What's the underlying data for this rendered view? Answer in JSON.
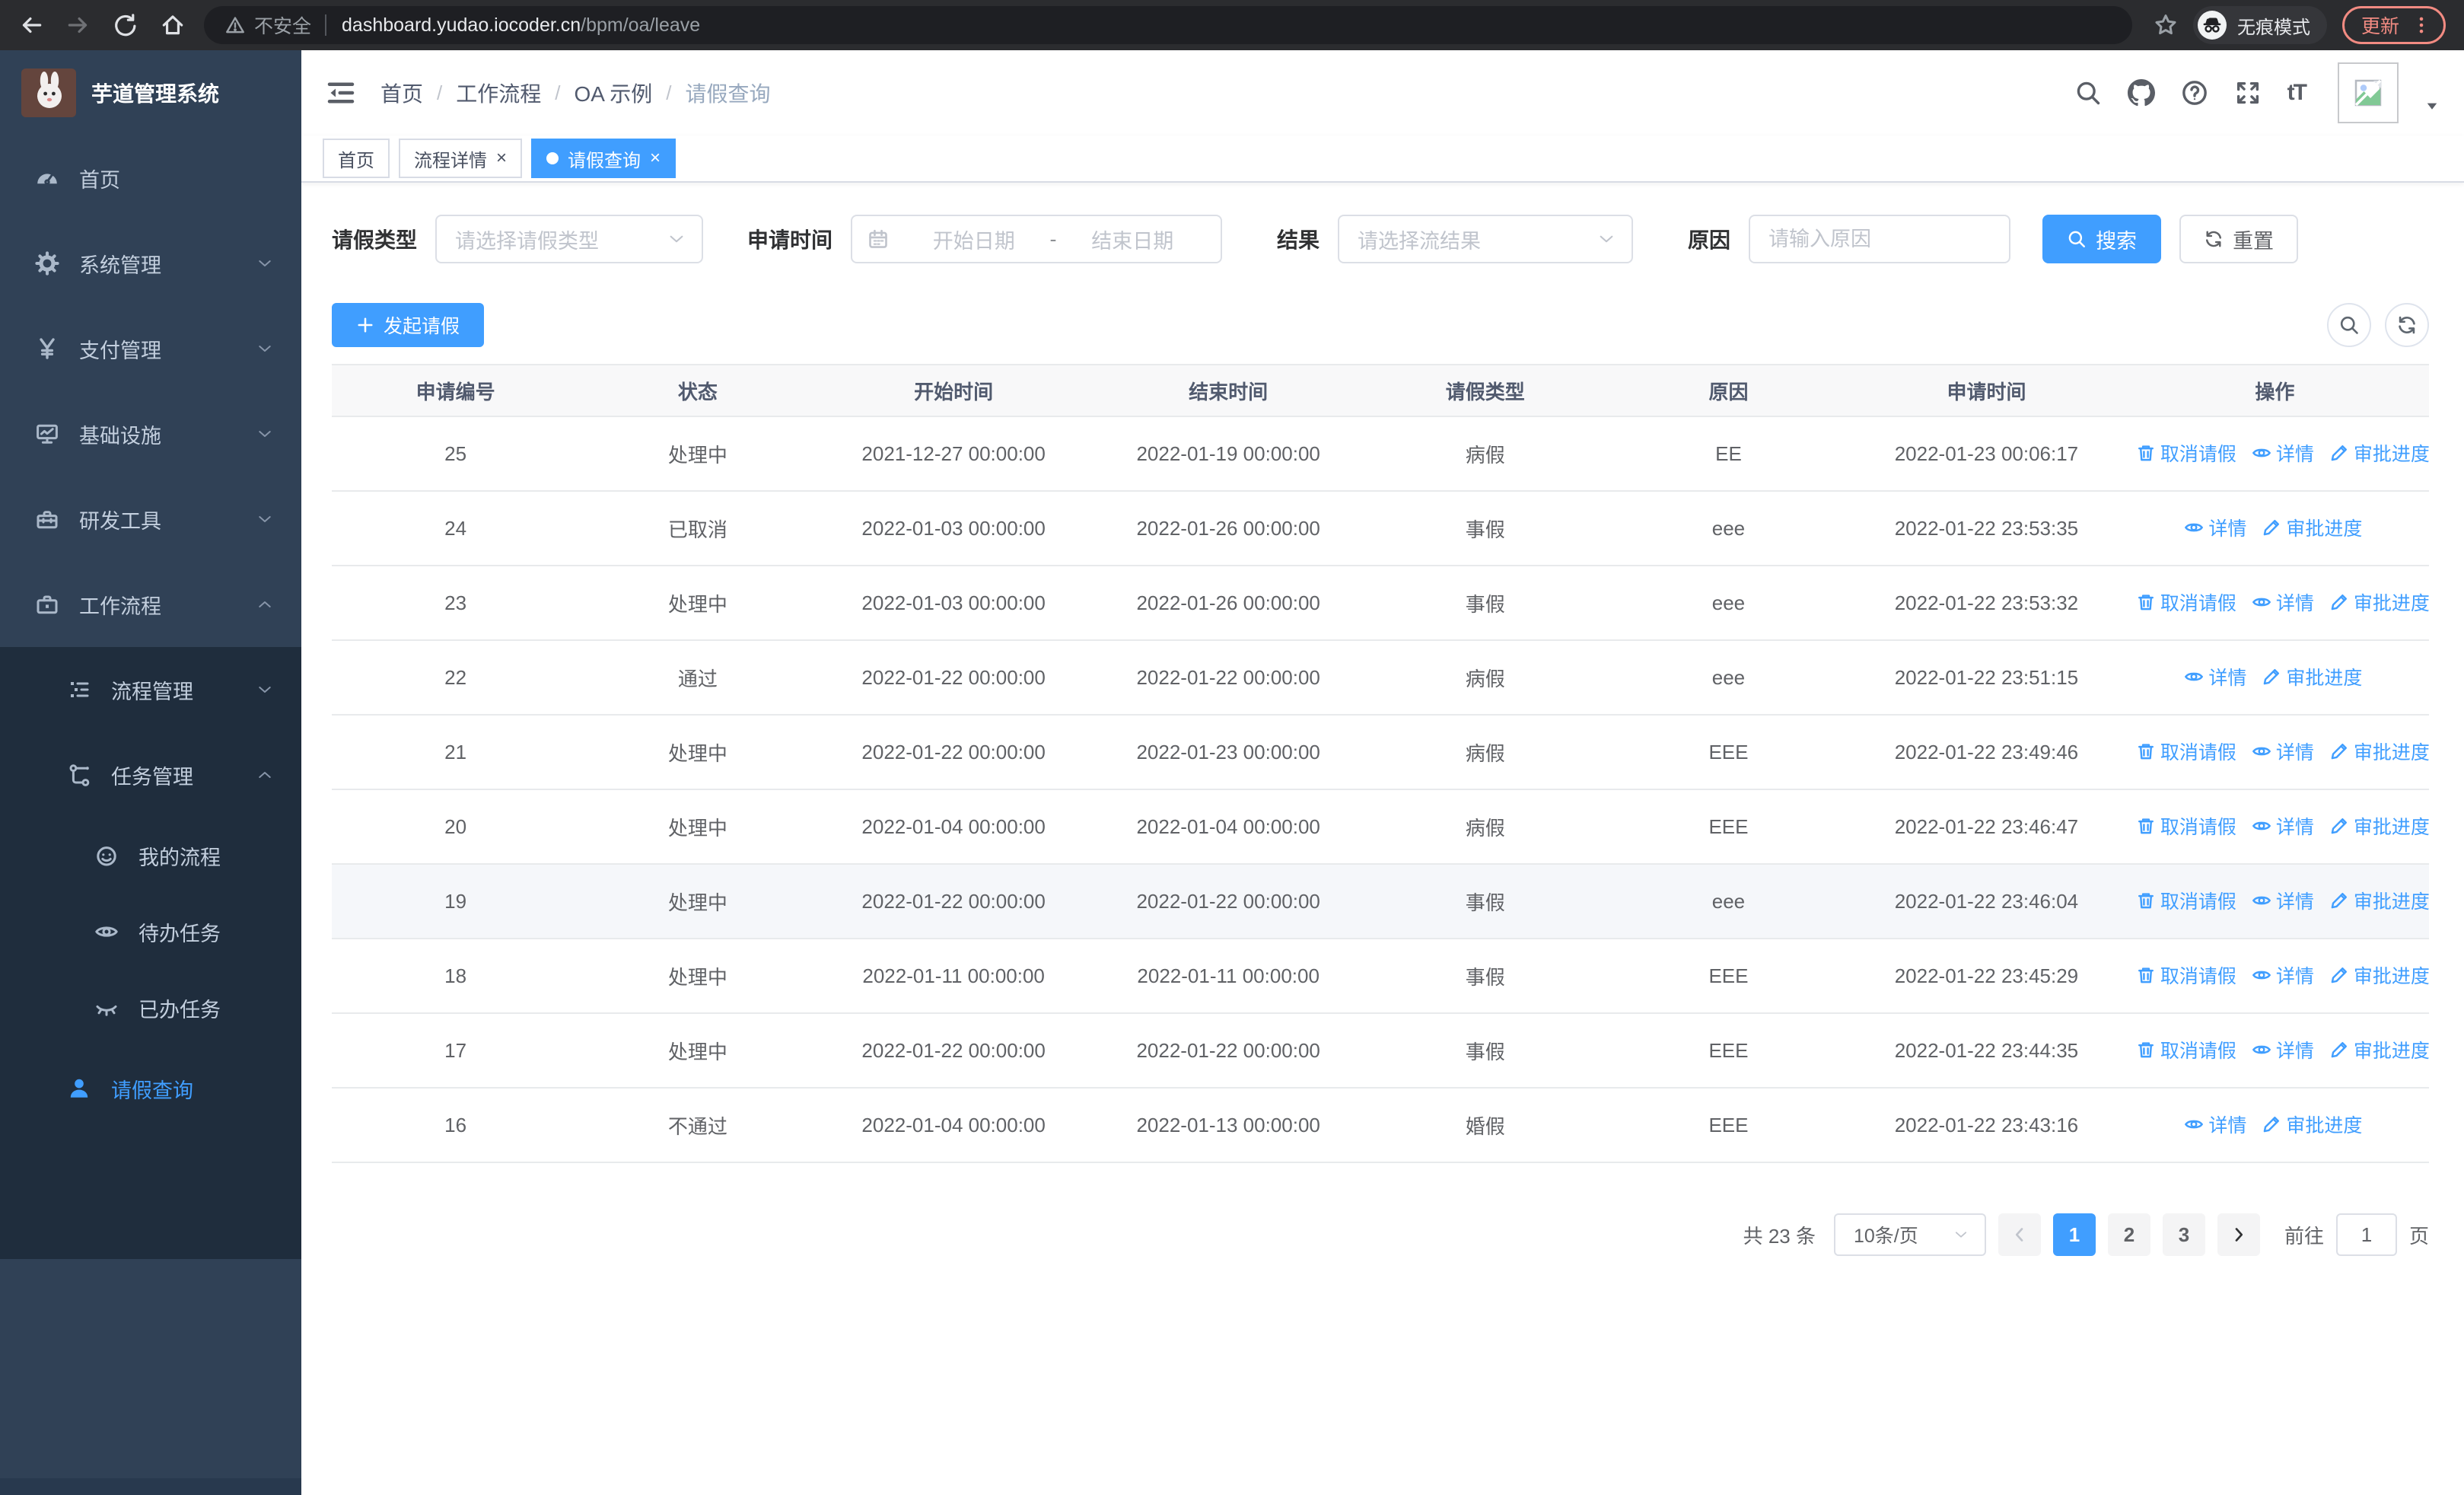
{
  "colors": {
    "primary": "#409EFF",
    "sidebar_bg": "#304156",
    "submenu_bg": "#1f2d3d",
    "update_accent": "#f28b82"
  },
  "browser": {
    "security_text": "不安全",
    "url_host": "dashboard.yudao.iocoder.cn",
    "url_path": "/bpm/oa/leave",
    "incognito_label": "无痕模式",
    "update_label": "更新"
  },
  "sidebar": {
    "title": "芋道管理系统",
    "menu": [
      {
        "name": "home",
        "label": "首页",
        "icon": "gauge"
      },
      {
        "name": "system-mgmt",
        "label": "系统管理",
        "icon": "gear",
        "chevron": "down"
      },
      {
        "name": "payment-mgmt",
        "label": "支付管理",
        "icon": "yen",
        "chevron": "down"
      },
      {
        "name": "infrastructure",
        "label": "基础设施",
        "icon": "monitor",
        "chevron": "down"
      },
      {
        "name": "dev-tools",
        "label": "研发工具",
        "icon": "toolbox",
        "chevron": "down"
      },
      {
        "name": "workflow",
        "label": "工作流程",
        "icon": "briefcase",
        "chevron": "up",
        "children": [
          {
            "name": "process-mgmt",
            "label": "流程管理",
            "icon": "tree",
            "chevron": "down",
            "level": 2
          },
          {
            "name": "task-mgmt",
            "label": "任务管理",
            "icon": "workflow",
            "chevron": "up",
            "level": 2,
            "children": [
              {
                "name": "my-process",
                "label": "我的流程",
                "icon": "face",
                "level": 3
              },
              {
                "name": "todo-tasks",
                "label": "待办任务",
                "icon": "eye",
                "level": 3
              },
              {
                "name": "done-tasks",
                "label": "已办任务",
                "icon": "eye-closed",
                "level": 3
              }
            ]
          },
          {
            "name": "leave-query",
            "label": "请假查询",
            "icon": "person",
            "level": 2,
            "active": true
          }
        ]
      }
    ]
  },
  "header": {
    "breadcrumb": [
      "首页",
      "工作流程",
      "OA 示例",
      "请假查询"
    ]
  },
  "tabs": [
    {
      "name": "home",
      "label": "首页",
      "closable": false,
      "active": false
    },
    {
      "name": "process-detail",
      "label": "流程详情",
      "closable": true,
      "active": false
    },
    {
      "name": "leave-query",
      "label": "请假查询",
      "closable": true,
      "active": true
    }
  ],
  "filters": {
    "leave_type_label": "请假类型",
    "leave_type_placeholder": "请选择请假类型",
    "apply_time_label": "申请时间",
    "date_start_placeholder": "开始日期",
    "date_separator": "-",
    "date_end_placeholder": "结束日期",
    "result_label": "结果",
    "result_placeholder": "请选择流结果",
    "reason_label": "原因",
    "reason_placeholder": "请输入原因",
    "search_label": "搜索",
    "reset_label": "重置"
  },
  "toolbar": {
    "create_label": "发起请假"
  },
  "table": {
    "columns": [
      "申请编号",
      "状态",
      "开始时间",
      "结束时间",
      "请假类型",
      "原因",
      "申请时间",
      "操作"
    ],
    "action_defs": {
      "cancel": {
        "label": "取消请假",
        "icon": "trash"
      },
      "detail": {
        "label": "详情",
        "icon": "eye"
      },
      "progress": {
        "label": "审批进度",
        "icon": "pencil"
      }
    },
    "rows": [
      {
        "id": "25",
        "status": "处理中",
        "start": "2021-12-27 00:00:00",
        "end": "2022-01-19 00:00:00",
        "type": "病假",
        "reason": "EE",
        "applied": "2022-01-23 00:06:17",
        "actions": [
          "cancel",
          "detail",
          "progress"
        ]
      },
      {
        "id": "24",
        "status": "已取消",
        "start": "2022-01-03 00:00:00",
        "end": "2022-01-26 00:00:00",
        "type": "事假",
        "reason": "eee",
        "applied": "2022-01-22 23:53:35",
        "actions": [
          "detail",
          "progress"
        ]
      },
      {
        "id": "23",
        "status": "处理中",
        "start": "2022-01-03 00:00:00",
        "end": "2022-01-26 00:00:00",
        "type": "事假",
        "reason": "eee",
        "applied": "2022-01-22 23:53:32",
        "actions": [
          "cancel",
          "detail",
          "progress"
        ]
      },
      {
        "id": "22",
        "status": "通过",
        "start": "2022-01-22 00:00:00",
        "end": "2022-01-22 00:00:00",
        "type": "病假",
        "reason": "eee",
        "applied": "2022-01-22 23:51:15",
        "actions": [
          "detail",
          "progress"
        ]
      },
      {
        "id": "21",
        "status": "处理中",
        "start": "2022-01-22 00:00:00",
        "end": "2022-01-23 00:00:00",
        "type": "病假",
        "reason": "EEE",
        "applied": "2022-01-22 23:49:46",
        "actions": [
          "cancel",
          "detail",
          "progress"
        ]
      },
      {
        "id": "20",
        "status": "处理中",
        "start": "2022-01-04 00:00:00",
        "end": "2022-01-04 00:00:00",
        "type": "病假",
        "reason": "EEE",
        "applied": "2022-01-22 23:46:47",
        "actions": [
          "cancel",
          "detail",
          "progress"
        ]
      },
      {
        "id": "19",
        "status": "处理中",
        "start": "2022-01-22 00:00:00",
        "end": "2022-01-22 00:00:00",
        "type": "事假",
        "reason": "eee",
        "applied": "2022-01-22 23:46:04",
        "actions": [
          "cancel",
          "detail",
          "progress"
        ],
        "highlight": true
      },
      {
        "id": "18",
        "status": "处理中",
        "start": "2022-01-11 00:00:00",
        "end": "2022-01-11 00:00:00",
        "type": "事假",
        "reason": "EEE",
        "applied": "2022-01-22 23:45:29",
        "actions": [
          "cancel",
          "detail",
          "progress"
        ]
      },
      {
        "id": "17",
        "status": "处理中",
        "start": "2022-01-22 00:00:00",
        "end": "2022-01-22 00:00:00",
        "type": "事假",
        "reason": "EEE",
        "applied": "2022-01-22 23:44:35",
        "actions": [
          "cancel",
          "detail",
          "progress"
        ]
      },
      {
        "id": "16",
        "status": "不通过",
        "start": "2022-01-04 00:00:00",
        "end": "2022-01-13 00:00:00",
        "type": "婚假",
        "reason": "EEE",
        "applied": "2022-01-22 23:43:16",
        "actions": [
          "detail",
          "progress"
        ]
      }
    ]
  },
  "pagination": {
    "total_text": "共 23 条",
    "page_size": "10条/页",
    "pages": [
      "1",
      "2",
      "3"
    ],
    "active_page": "1",
    "goto_label": "前往",
    "goto_value": "1",
    "page_unit": "页"
  }
}
